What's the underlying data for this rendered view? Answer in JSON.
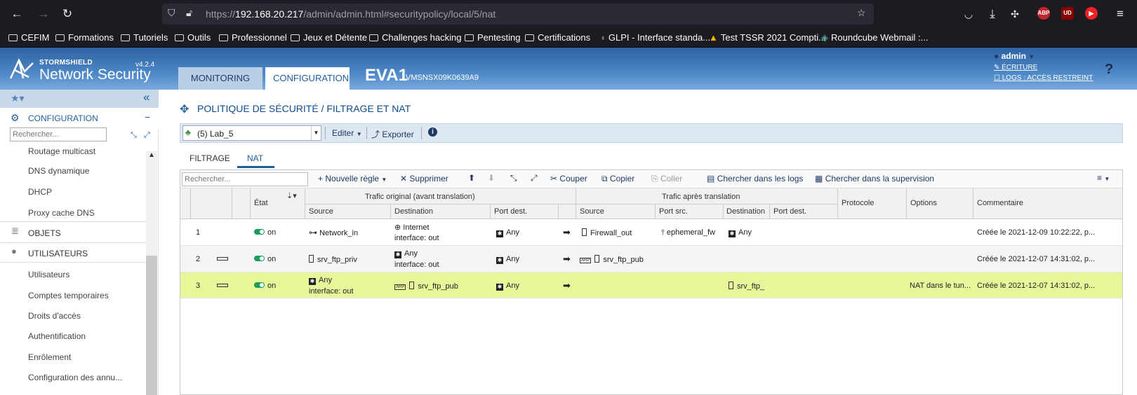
{
  "browser": {
    "url_prefix": "https://",
    "url_host": "192.168.20.217",
    "url_path": "/admin/admin.html#securitypolicy/local/5/nat",
    "ext_abp": "ABP",
    "ext_ub": "UD",
    "bookmarks": [
      "CEFIM",
      "Formations",
      "Tutoriels",
      "Outils",
      "Professionnel",
      "Jeux et Détente",
      "Challenges hacking",
      "Pentesting",
      "Certifications",
      "GLPI - Interface standa...",
      "Test TSSR 2021 Compti...",
      "Roundcube Webmail :..."
    ]
  },
  "app": {
    "logo_top": "STORMSHIELD",
    "logo_main": "Network Security",
    "version": "v4.2.4",
    "tabs": [
      "MONITORING",
      "CONFIGURATION"
    ],
    "device": "EVA1",
    "serial": "VMSNSX09K0639A9",
    "user": "admin",
    "write_link": "ÉCRITURE",
    "logs_link": "LOGS : ACCÈS RESTREINT",
    "help": "?"
  },
  "sidebar": {
    "section": "CONFIGURATION",
    "search_placeholder": "Rechercher...",
    "items_top": [
      "Routage multicast",
      "DNS dynamique",
      "DHCP",
      "Proxy cache DNS"
    ],
    "objects": "OBJETS",
    "users": "UTILISATEURS",
    "items_users": [
      "Utilisateurs",
      "Comptes temporaires",
      "Droits d'accès",
      "Authentification",
      "Enrôlement",
      "Configuration des annu..."
    ]
  },
  "page": {
    "title": "POLITIQUE DE SÉCURITÉ / FILTRAGE ET NAT",
    "policy": "(5) Lab_5",
    "edit": "Editer",
    "export": "Exporter",
    "subtabs": [
      "FILTRAGE",
      "NAT"
    ],
    "grid_search_placeholder": "Rechercher...",
    "tools": {
      "new_rule": "Nouvelle règle",
      "delete": "Supprimer",
      "cut": "Couper",
      "copy": "Copier",
      "paste": "Coller",
      "search_logs": "Chercher dans les logs",
      "search_supervision": "Chercher dans la supervision"
    }
  },
  "grid": {
    "headers": {
      "state": "État",
      "orig": "Trafic original (avant translation)",
      "after": "Trafic après translation",
      "protocol": "Protocole",
      "options": "Options",
      "comment": "Commentaire",
      "src": "Source",
      "dst": "Destination",
      "port_dst": "Port dest.",
      "a_src": "Source",
      "a_port_src": "Port src.",
      "a_dst": "Destination",
      "a_port_dst": "Port dest."
    },
    "rows": [
      {
        "num": "1",
        "state": "on",
        "src": "Network_in",
        "dst1": "Internet",
        "dst2": "interface: out",
        "port": "Any",
        "a_src": "Firewall_out",
        "a_port_src": "ephemeral_fw",
        "a_dst": "Any",
        "options": "",
        "comment": "Créée le 2021-12-09 10:22:22, p..."
      },
      {
        "num": "2",
        "state": "on",
        "src": "srv_ftp_priv",
        "dst1": "Any",
        "dst2": "interface: out",
        "port": "Any",
        "a_src": "srv_ftp_pub",
        "a_port_src": "",
        "a_dst": "",
        "options": "",
        "comment": "Créée le 2021-12-07 14:31:02, p..."
      },
      {
        "num": "3",
        "state": "on",
        "src1": "Any",
        "src2": "interface: out",
        "dst": "srv_ftp_pub",
        "port": "Any",
        "a_src": "",
        "a_port_src": "",
        "a_dst": "srv_ftp_",
        "options": "NAT dans le tun...",
        "comment": "Créée le 2021-12-07 14:31:02, p..."
      }
    ]
  }
}
